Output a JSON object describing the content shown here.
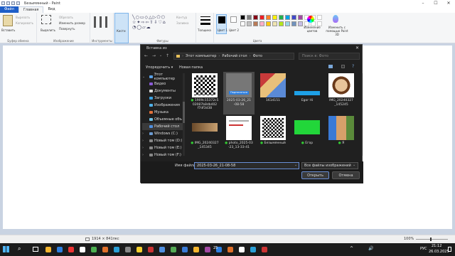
{
  "window": {
    "title": "Безымянный - Paint"
  },
  "ribbon_tabs": [
    "Файл",
    "Главная",
    "Вид"
  ],
  "ribbon": {
    "paste": "Вставить",
    "cut": "Вырезать",
    "copy": "Копировать",
    "clipboard_group": "Буфер обмена",
    "select": "Выделить",
    "crop": "Обрезать",
    "resize": "Изменить размер",
    "rotate": "Повернуть",
    "image_group": "Изображение",
    "tools_group": "Инструменты",
    "brushes": "Кисти",
    "outline": "Контур",
    "fill": "Заливка",
    "shapes_group": "Фигуры",
    "thickness": "Толщина",
    "color1": "Цвет 1",
    "color2": "Цвет 2",
    "edit_colors": "Изменение цветов",
    "paint3d": "Изменить с помощью Paint 3D",
    "colors_group": "Цвета",
    "palette": [
      "#000000",
      "#7f7f7f",
      "#880015",
      "#ed1c24",
      "#ff7f27",
      "#fff200",
      "#22b14c",
      "#00a2e8",
      "#3f48cc",
      "#a349a4",
      "#ffffff",
      "#c3c3c3",
      "#b97a57",
      "#ffaec9",
      "#ffc90e",
      "#efe4b0",
      "#b5e61d",
      "#99d9ea",
      "#7092be",
      "#c8bfe7"
    ]
  },
  "dialog": {
    "title": "Вставка из",
    "path": [
      "Этот компьютер",
      "Рабочий стол",
      "Фото"
    ],
    "search_placeholder": "Поиск в: Фото",
    "organize": "Упорядочить ▾",
    "new_folder": "Новая папка",
    "sidebar": [
      "Этот компьютер",
      "Видео",
      "Документы",
      "Загрузки",
      "Изображения",
      "Музыка",
      "Объемные объ",
      "Рабочий стол",
      "Windows (C:)",
      "Новый том (D:)",
      "Новый том (E:)",
      "Новый том (F:)"
    ],
    "files": [
      {
        "name": "1909c15372c5 02087b8db402 f7df3d38",
        "kind": "qr"
      },
      {
        "name": "2025-03-26_21 -08-58",
        "kind": "selected",
        "badge": "Подписаться"
      },
      {
        "name": "1614151",
        "kind": "cartoon"
      },
      {
        "name": "Egor Hi",
        "kind": "blue"
      },
      {
        "name": "IMG_20240327 _145245",
        "kind": "face"
      },
      {
        "name": "IMG_20240327 _145345",
        "kind": "tan"
      },
      {
        "name": "photo_2025-03 -23_13-33-41",
        "kind": "doc"
      },
      {
        "name": "Безымянный",
        "kind": "qr"
      },
      {
        "name": "Егор",
        "kind": "green"
      },
      {
        "name": "Я",
        "kind": "photo"
      }
    ],
    "filename_label": "Имя файла:",
    "filename_value": "2025-03-26_21-08-58",
    "filetype": "Все файлы изображений",
    "open": "Открыть",
    "cancel": "Отмена"
  },
  "status": {
    "size": "1914 × 841пкс",
    "zoom": "100%"
  },
  "taskbar": {
    "lang": "РУС",
    "time": "21:12",
    "date": "26.03.2025",
    "weather": "25"
  }
}
